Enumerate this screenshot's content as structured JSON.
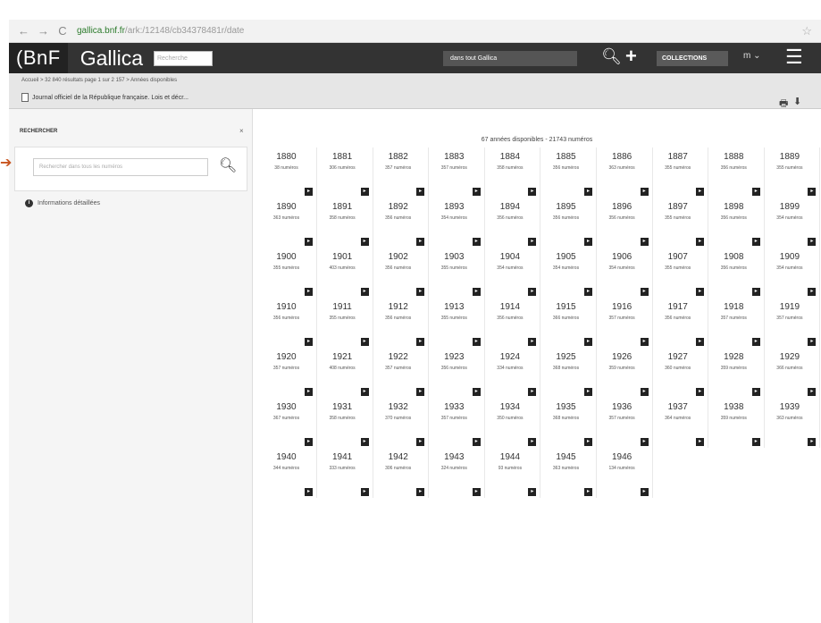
{
  "browser": {
    "url_host": "gallica.bnf.fr",
    "url_path": "/ark:/12148/cb34378481r/date"
  },
  "header": {
    "bnf": "(BnF",
    "gallica": "Gallica",
    "search_placeholder": "Recherche",
    "scope": "dans tout Gallica",
    "collections": "COLLECTIONS",
    "lang": "m ⌄"
  },
  "subbar": {
    "breadcrumb": "Accueil > 32 840 résultats page 1 sur 2 157 > Années disponibles",
    "title": "Journal officiel de la République française. Lois et décr..."
  },
  "sidebar": {
    "tab": "RECHERCHER",
    "close": "×",
    "search_placeholder": "Rechercher dans tous les numéros",
    "info": "Informations détaillées"
  },
  "main": {
    "counter": "67 années disponibles - 21743 numéros"
  },
  "years": [
    {
      "year": "1880",
      "count": "38 numéros"
    },
    {
      "year": "1881",
      "count": "306 numéros"
    },
    {
      "year": "1882",
      "count": "357 numéros"
    },
    {
      "year": "1883",
      "count": "357 numéros"
    },
    {
      "year": "1884",
      "count": "358 numéros"
    },
    {
      "year": "1885",
      "count": "356 numéros"
    },
    {
      "year": "1886",
      "count": "363 numéros"
    },
    {
      "year": "1887",
      "count": "355 numéros"
    },
    {
      "year": "1888",
      "count": "356 numéros"
    },
    {
      "year": "1889",
      "count": "355 numéros"
    },
    {
      "year": "1890",
      "count": "363 numéros"
    },
    {
      "year": "1891",
      "count": "358 numéros"
    },
    {
      "year": "1892",
      "count": "356 numéros"
    },
    {
      "year": "1893",
      "count": "354 numéros"
    },
    {
      "year": "1894",
      "count": "356 numéros"
    },
    {
      "year": "1895",
      "count": "356 numéros"
    },
    {
      "year": "1896",
      "count": "356 numéros"
    },
    {
      "year": "1897",
      "count": "355 numéros"
    },
    {
      "year": "1898",
      "count": "356 numéros"
    },
    {
      "year": "1899",
      "count": "354 numéros"
    },
    {
      "year": "1900",
      "count": "355 numéros"
    },
    {
      "year": "1901",
      "count": "403 numéros"
    },
    {
      "year": "1902",
      "count": "356 numéros"
    },
    {
      "year": "1903",
      "count": "355 numéros"
    },
    {
      "year": "1904",
      "count": "354 numéros"
    },
    {
      "year": "1905",
      "count": "354 numéros"
    },
    {
      "year": "1906",
      "count": "354 numéros"
    },
    {
      "year": "1907",
      "count": "355 numéros"
    },
    {
      "year": "1908",
      "count": "356 numéros"
    },
    {
      "year": "1909",
      "count": "354 numéros"
    },
    {
      "year": "1910",
      "count": "356 numéros"
    },
    {
      "year": "1911",
      "count": "355 numéros"
    },
    {
      "year": "1912",
      "count": "356 numéros"
    },
    {
      "year": "1913",
      "count": "355 numéros"
    },
    {
      "year": "1914",
      "count": "356 numéros"
    },
    {
      "year": "1915",
      "count": "366 numéros"
    },
    {
      "year": "1916",
      "count": "357 numéros"
    },
    {
      "year": "1917",
      "count": "356 numéros"
    },
    {
      "year": "1918",
      "count": "357 numéros"
    },
    {
      "year": "1919",
      "count": "357 numéros"
    },
    {
      "year": "1920",
      "count": "357 numéros"
    },
    {
      "year": "1921",
      "count": "408 numéros"
    },
    {
      "year": "1922",
      "count": "357 numéros"
    },
    {
      "year": "1923",
      "count": "356 numéros"
    },
    {
      "year": "1924",
      "count": "334 numéros"
    },
    {
      "year": "1925",
      "count": "368 numéros"
    },
    {
      "year": "1926",
      "count": "359 numéros"
    },
    {
      "year": "1927",
      "count": "360 numéros"
    },
    {
      "year": "1928",
      "count": "359 numéros"
    },
    {
      "year": "1929",
      "count": "366 numéros"
    },
    {
      "year": "1930",
      "count": "367 numéros"
    },
    {
      "year": "1931",
      "count": "358 numéros"
    },
    {
      "year": "1932",
      "count": "370 numéros"
    },
    {
      "year": "1933",
      "count": "357 numéros"
    },
    {
      "year": "1934",
      "count": "350 numéros"
    },
    {
      "year": "1935",
      "count": "368 numéros"
    },
    {
      "year": "1936",
      "count": "357 numéros"
    },
    {
      "year": "1937",
      "count": "364 numéros"
    },
    {
      "year": "1938",
      "count": "359 numéros"
    },
    {
      "year": "1939",
      "count": "363 numéros"
    },
    {
      "year": "1940",
      "count": "344 numéros"
    },
    {
      "year": "1941",
      "count": "333 numéros"
    },
    {
      "year": "1942",
      "count": "306 numéros"
    },
    {
      "year": "1943",
      "count": "324 numéros"
    },
    {
      "year": "1944",
      "count": "93 numéros"
    },
    {
      "year": "1945",
      "count": "363 numéros"
    },
    {
      "year": "1946",
      "count": "134 numéros"
    }
  ],
  "icons": {
    "back": "back-arrow-icon",
    "forward": "forward-arrow-icon",
    "reload": "reload-icon",
    "search": "search-icon",
    "plus": "plus-icon",
    "menu": "hamburger-menu-icon",
    "print": "print-icon",
    "download": "download-icon",
    "info": "info-icon",
    "open": "open-calendar-icon"
  },
  "colors": {
    "header_bg": "#333333",
    "accent_arrow": "#c8541f"
  }
}
